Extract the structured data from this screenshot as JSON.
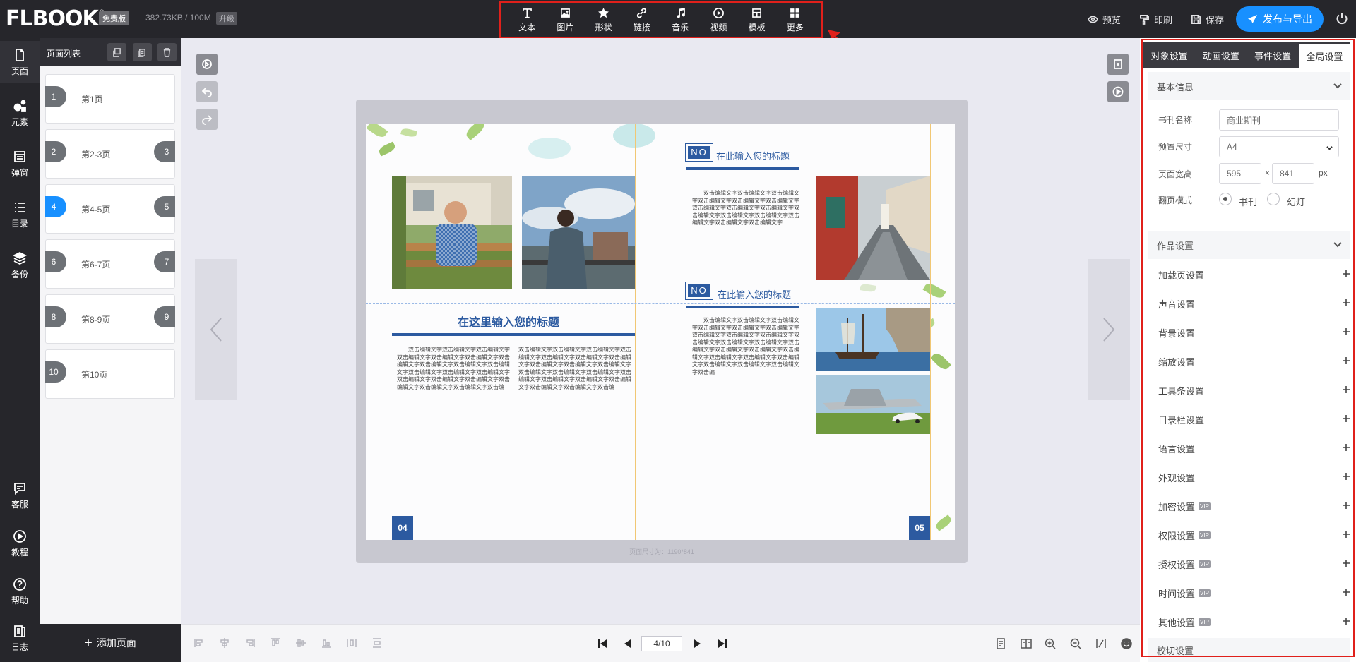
{
  "header": {
    "logo": "FLBOOK",
    "logo_sup": "®",
    "plan_badge": "免费版",
    "storage": "382.73KB / 100M",
    "upgrade": "升级",
    "tools": [
      {
        "label": "文本",
        "icon": "text-icon"
      },
      {
        "label": "图片",
        "icon": "image-icon"
      },
      {
        "label": "形状",
        "icon": "star-icon"
      },
      {
        "label": "链接",
        "icon": "link-icon"
      },
      {
        "label": "音乐",
        "icon": "music-icon"
      },
      {
        "label": "视频",
        "icon": "video-icon"
      },
      {
        "label": "模板",
        "icon": "template-icon"
      },
      {
        "label": "更多",
        "icon": "more-icon"
      }
    ],
    "preview": "预览",
    "print": "印刷",
    "save": "保存",
    "publish": "发布与导出"
  },
  "rail": {
    "items": [
      {
        "label": "页面",
        "icon": "page-icon"
      },
      {
        "label": "元素",
        "icon": "elements-icon"
      },
      {
        "label": "弹窗",
        "icon": "popup-icon"
      },
      {
        "label": "目录",
        "icon": "toc-icon"
      },
      {
        "label": "备份",
        "icon": "backup-icon"
      }
    ],
    "bottom": [
      {
        "label": "客服",
        "icon": "chat-icon"
      },
      {
        "label": "教程",
        "icon": "play-icon"
      },
      {
        "label": "帮助",
        "icon": "help-icon"
      },
      {
        "label": "日志",
        "icon": "log-icon"
      }
    ]
  },
  "page_list": {
    "title": "页面列表",
    "pages": [
      {
        "label": "第1页",
        "left": "1",
        "right": ""
      },
      {
        "label": "第2-3页",
        "left": "2",
        "right": "3"
      },
      {
        "label": "第4-5页",
        "left": "4",
        "right": "5"
      },
      {
        "label": "第6-7页",
        "left": "6",
        "right": "7"
      },
      {
        "label": "第8-9页",
        "left": "8",
        "right": "9"
      },
      {
        "label": "第10页",
        "left": "10",
        "right": ""
      }
    ],
    "active_index": 2,
    "add_page": "添加页面"
  },
  "book": {
    "main_title": "在这里输入您的标题",
    "no_label": "NO",
    "sub_title_1": "在此输入您的标题",
    "sub_title_2": "在此输入您的标题",
    "para_unit": "双击编辑文字",
    "page_left": "04",
    "page_right": "05",
    "page_size": "页面尺寸为：1190*841"
  },
  "bottom": {
    "page_indicator": "4/10"
  },
  "settings": {
    "tabs": [
      "对象设置",
      "动画设置",
      "事件设置",
      "全局设置"
    ],
    "active_tab": 3,
    "basic_info": "基本信息",
    "book_name_label": "书刊名称",
    "book_name_value": "商业期刊",
    "preset_size_label": "预置尺寸",
    "preset_size_value": "A4",
    "page_wh_label": "页面宽高",
    "width": "595",
    "times": "×",
    "height": "841",
    "unit": "px",
    "flip_mode_label": "翻页模式",
    "flip_book": "书刊",
    "flip_slide": "幻灯",
    "work_settings": "作品设置",
    "rows": [
      {
        "label": "加载页设置",
        "vip": false
      },
      {
        "label": "声音设置",
        "vip": false
      },
      {
        "label": "背景设置",
        "vip": false
      },
      {
        "label": "缩放设置",
        "vip": false
      },
      {
        "label": "工具条设置",
        "vip": false
      },
      {
        "label": "目录栏设置",
        "vip": false
      },
      {
        "label": "语言设置",
        "vip": false
      },
      {
        "label": "外观设置",
        "vip": false
      },
      {
        "label": "加密设置",
        "vip": true
      },
      {
        "label": "权限设置",
        "vip": true
      },
      {
        "label": "授权设置",
        "vip": true
      },
      {
        "label": "时间设置",
        "vip": true
      },
      {
        "label": "其他设置",
        "vip": true
      }
    ],
    "vip_badge": "VIP",
    "cut_section": "校切设置"
  },
  "colors": {
    "accent": "#1890ff",
    "dark_bar": "#26262b",
    "book_blue": "#2c5aa0",
    "highlight": "#e0201b"
  }
}
